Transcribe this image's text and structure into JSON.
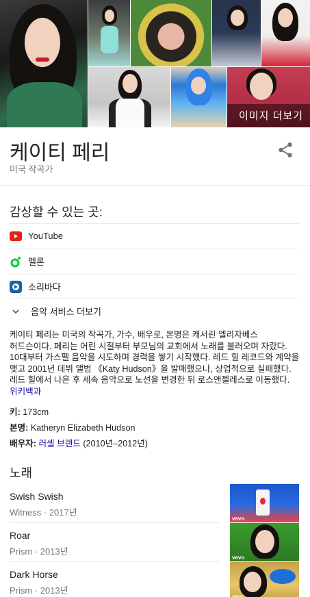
{
  "images": {
    "more_label": "이미지 더보기"
  },
  "entity": {
    "title": "케이티 페리",
    "subtitle": "미국 작곡가"
  },
  "watch": {
    "heading": "감상할 수 있는 곳:",
    "services": [
      {
        "label": "YouTube",
        "icon": "youtube-icon",
        "color": "#e62117"
      },
      {
        "label": "멜론",
        "icon": "melon-icon",
        "color": "#00cd3c"
      },
      {
        "label": "소리바다",
        "icon": "soribada-icon",
        "color": "#1a5fa8"
      }
    ],
    "more_label": "음악 서비스 더보기"
  },
  "description": {
    "text": "케이티 페리는 미국의 작곡가, 가수, 배우로, 본명은 캐서린 엘리자베스 허드슨이다. 페리는 어린 시절부터 부모님의 교회에서 노래를 불러오며 자랐다. 10대부터 가스펠 음악을 시도하며 경력을 쌓기 시작했다. 레드 힐 레코드와 계약을 맺고 2001년 데뷔 앨범 《Katy Hudson》을 발매했으나, 상업적으로 실패했다. 레드 힐에서 나온 후 세속 음악으로 노선을 변경한 뒤 로스앤젤레스로 이동했다. ",
    "link": "위키백과"
  },
  "facts": {
    "height_label": "키:",
    "height_value": "173cm",
    "name_label": "본명:",
    "name_value": "Katheryn Elizabeth Hudson",
    "spouse_label": "배우자:",
    "spouse_link": "러셀 브랜드",
    "spouse_years": "(2010년–2012년)"
  },
  "songs": {
    "heading": "노래",
    "items": [
      {
        "title": "Swish Swish",
        "meta": "Witness · 2017년",
        "thumb_label": "vevo"
      },
      {
        "title": "Roar",
        "meta": "Prism · 2013년",
        "thumb_label": "vevo"
      },
      {
        "title": "Dark Horse",
        "meta": "Prism · 2013년",
        "thumb_label": "vevo"
      }
    ]
  }
}
